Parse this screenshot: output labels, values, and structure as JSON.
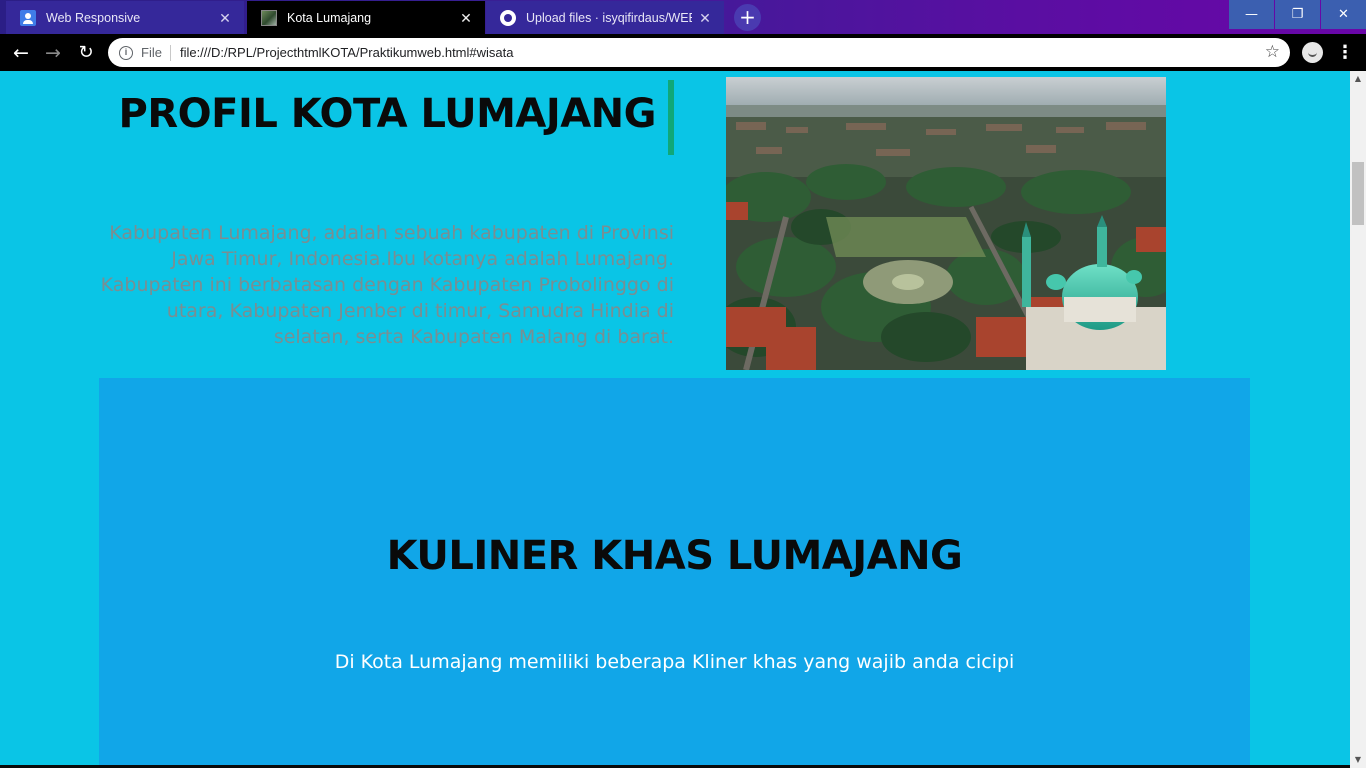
{
  "browser": {
    "tabs": [
      {
        "title": "Web Responsive",
        "icon": "profile-icon",
        "active": false
      },
      {
        "title": "Kota Lumajang",
        "icon": "photo-icon",
        "active": true
      },
      {
        "title": "Upload files · isyqifirdaus/WEBKo",
        "icon": "github-icon",
        "active": false
      }
    ],
    "new_tab_symbol": "+",
    "window_controls": {
      "minimize": "—",
      "maximize": "❐",
      "close": "✕"
    },
    "toolbar": {
      "back_symbol": "←",
      "forward_symbol": "→",
      "reload_symbol": "↻",
      "scheme_label": "File",
      "url": "file:///D:/RPL/ProjecthtmlKOTA/Praktikumweb.html#wisata",
      "bookmark_symbol": "☆",
      "menu_symbol": "⋮"
    }
  },
  "page": {
    "profil": {
      "title": "PROFIL KOTA LUMAJANG",
      "description": "Kabupaten Lumajang, adalah sebuah kabupaten di Provinsi Jawa Timur, Indonesia.Ibu kotanya adalah Lumajang. Kabupaten ini berbatasan dengan Kabupaten Probolinggo di utara, Kabupaten Jember di timur, Samudra Hindia di selatan, serta Kabupaten Malang di barat."
    },
    "kuliner": {
      "title": "KULINER KHAS LUMAJANG",
      "description": "Di Kota Lumajang memiliki beberapa Kliner khas yang wajib anda cicipi"
    }
  },
  "colors": {
    "page_background": "#0ac5e6",
    "kuliner_background": "#11a6e8",
    "title_accent": "#10a878",
    "description_text": "#7a8e92"
  }
}
